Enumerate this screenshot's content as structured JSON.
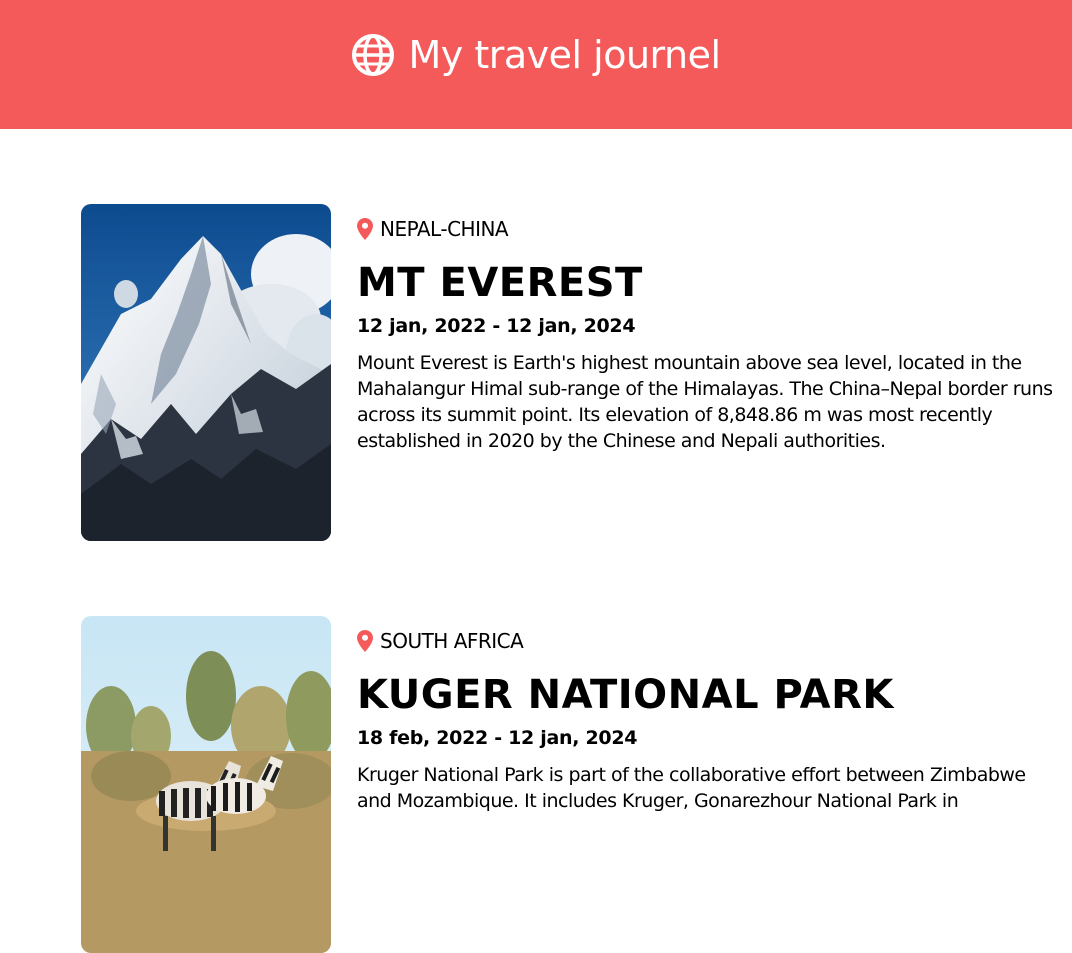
{
  "header": {
    "title": "My travel journel",
    "icon": "globe-icon",
    "background": "#f55a5a"
  },
  "entries": [
    {
      "location": "NEPAL-CHINA",
      "title": "MT EVEREST",
      "dates": "12 jan, 2022 - 12 jan, 2024",
      "description": "Mount Everest is Earth's highest mountain above sea level, located in the Mahalangur Himal sub-range of the Himalayas. The China–Nepal border runs across its summit point. Its elevation of 8,848.86 m was most recently established in 2020 by the Chinese and Nepali authorities.",
      "image": "snowy mountain peak"
    },
    {
      "location": "SOUTH AFRICA",
      "title": "KUGER NATIONAL PARK",
      "dates": "18 feb, 2022 - 12 jan, 2024",
      "description": "Kruger National Park is part of the collaborative effort between Zimbabwe and Mozambique. It includes Kruger, Gonarezhour National Park in",
      "image": "zebras in savanna"
    }
  ],
  "pin_color": "#f55a5a"
}
